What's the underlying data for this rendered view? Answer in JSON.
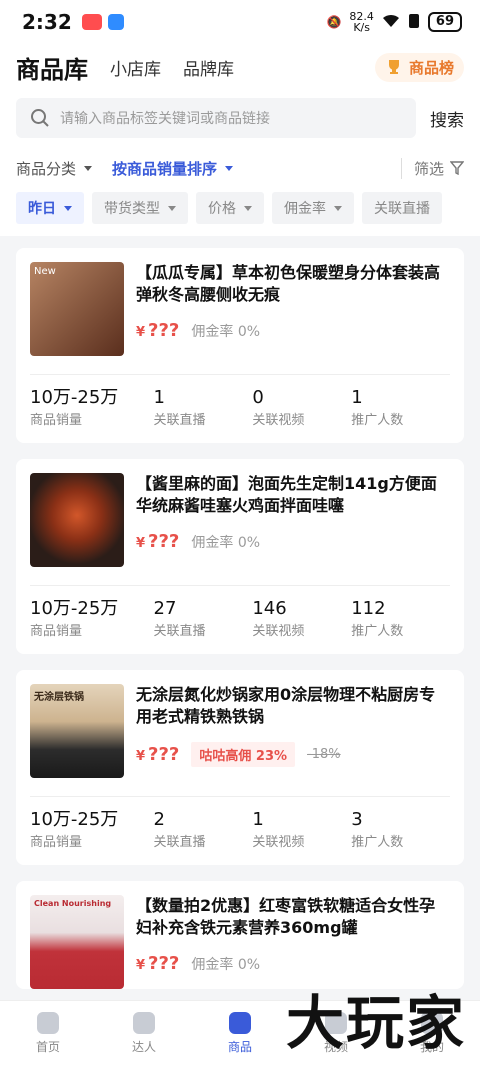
{
  "status": {
    "time": "2:32",
    "speed_value": "82.4",
    "speed_unit": "K/s",
    "battery": "69"
  },
  "header": {
    "tabs": [
      "商品库",
      "小店库",
      "品牌库"
    ],
    "rank_label": "商品榜"
  },
  "search": {
    "placeholder": "请输入商品标签关键词或商品链接",
    "button": "搜索"
  },
  "filters": {
    "category": "商品分类",
    "sort": "按商品销量排序",
    "screen": "筛选"
  },
  "chips": [
    "昨日",
    "带货类型",
    "价格",
    "佣金率",
    "关联直播"
  ],
  "products": [
    {
      "title": "【瓜瓜专属】草本初色保暖塑身分体套装高弹秋冬高腰侧收无痕",
      "yen": "¥",
      "price": "???",
      "commission": "佣金率 0%",
      "thumb_color": "#7a4a2c",
      "stats": [
        {
          "value": "10万-25万",
          "label": "商品销量"
        },
        {
          "value": "1",
          "label": "关联直播"
        },
        {
          "value": "0",
          "label": "关联视频"
        },
        {
          "value": "1",
          "label": "推广人数"
        }
      ]
    },
    {
      "title": "【酱里麻的面】泡面先生定制141g方便面华统麻酱哇塞火鸡面拌面哇噻",
      "yen": "¥",
      "price": "???",
      "commission": "佣金率 0%",
      "thumb_color": "#3b2a24",
      "stats": [
        {
          "value": "10万-25万",
          "label": "商品销量"
        },
        {
          "value": "27",
          "label": "关联直播"
        },
        {
          "value": "146",
          "label": "关联视频"
        },
        {
          "value": "112",
          "label": "推广人数"
        }
      ]
    },
    {
      "title": "无涂层氮化炒锅家用0涂层物理不粘厨房专用老式精铁熟铁锅",
      "yen": "¥",
      "price": "???",
      "commission_tag": "咕咕高佣 23%",
      "commission_old": "-18%",
      "thumb_color": "#cdb38f",
      "stats": [
        {
          "value": "10万-25万",
          "label": "商品销量"
        },
        {
          "value": "2",
          "label": "关联直播"
        },
        {
          "value": "1",
          "label": "关联视频"
        },
        {
          "value": "3",
          "label": "推广人数"
        }
      ]
    },
    {
      "title": "【数量拍2优惠】红枣富铁软糖适合女性孕妇补充含铁元素营养360mg罐",
      "yen": "¥",
      "price": "???",
      "commission": "佣金率 0%",
      "thumb_color": "#e9dfe0",
      "stats": []
    }
  ],
  "thumb_labels": [
    "New",
    "",
    "无涂层铁锅",
    "Clean Nourishing"
  ],
  "bottom_nav": [
    "首页",
    "达人",
    "商品",
    "视频",
    "我的"
  ],
  "watermark": "大玩家"
}
